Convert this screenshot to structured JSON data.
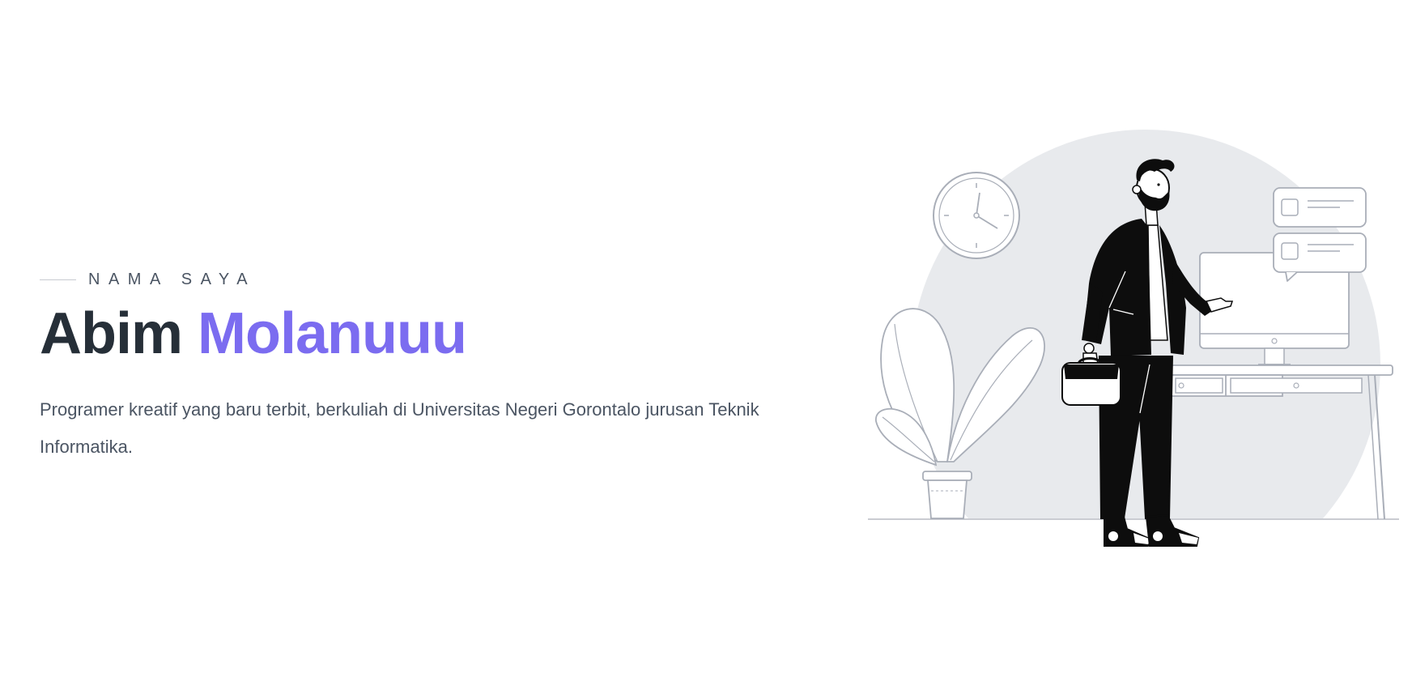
{
  "hero": {
    "eyebrow": "NAMA SAYA",
    "name_first": "Abim",
    "name_accent": "Molanuuu",
    "intro": "Programer kreatif yang baru terbit, berkuliah di Universitas Negeri Gorontalo jurusan Teknik Informatika."
  },
  "colors": {
    "heading": "#262f38",
    "accent": "#7b6cf0",
    "body_text": "#4b5563",
    "illustration_bg": "#e8eaed"
  },
  "illustration": {
    "icons": [
      "wall-clock-icon",
      "potted-plant-icon",
      "person-with-briefcase-icon",
      "desktop-monitor-icon",
      "chat-bubble-icon",
      "desk-icon"
    ]
  }
}
